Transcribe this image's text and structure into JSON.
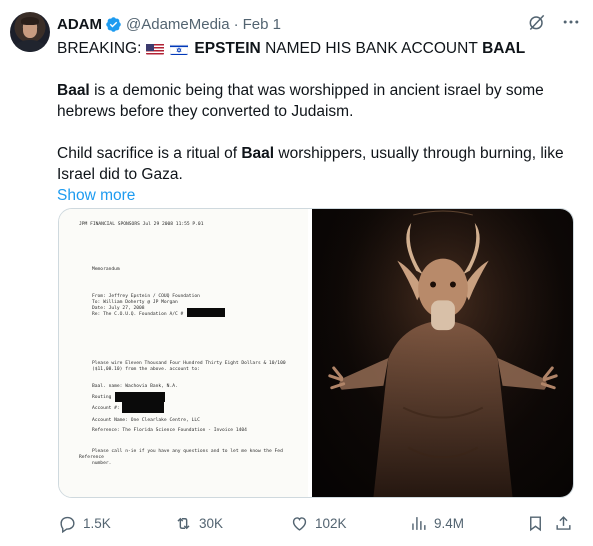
{
  "author": {
    "name": "ADAM",
    "handle": "@AdameMedia",
    "separator": "·",
    "date": "Feb 1",
    "verified": true
  },
  "tweet": {
    "line1_prefix": "BREAKING:",
    "line1_bold": "EPSTEIN",
    "line1_mid": "NAMED HIS BANK ACCOUNT",
    "line1_bold2": "BAAL",
    "p2_bold": "Baal",
    "p2_rest": "is a demonic being that was worshipped in ancient israel by some hebrews before they converted to Judaism.",
    "p3_start": "Child sacrifice is a ritual of",
    "p3_bold": "Baal",
    "p3_rest": "worshippers, usually through burning, like Israel did to Gaza.",
    "show_more": "Show more"
  },
  "flags": [
    "us-flag-icon",
    "israel-flag-icon"
  ],
  "document_image": {
    "header": "JPM FINANCIAL SPONSORS   Jul 29 2008 11:55 P.01",
    "memo": "Memorandum",
    "from": "From: Jeffrey Epstein / COUQ Foundation",
    "to": "To: William Doherty @ JP Morgan",
    "date": "Date: July 27, 2008",
    "re": "Re: The C.O.U.Q. Foundation A/C #",
    "wire1": "Please wire Eleven Thousand Four Hundred Thirty Eight Dollars & 10/100",
    "wire2": "($11,08.10) from the above. account to:",
    "bank": "Baal. name: Wachovia Bank, N.A.",
    "routing": "Routing",
    "account": "Account #:",
    "account_name": "Account Name: One Clearlake Centre, LLC",
    "reference": "Reference: The Florida Science Foundation - Invoice 1404",
    "please1": "Please call n-ie if you have any questions and to let me know the Fed",
    "please2": "Reference",
    "please3": "number."
  },
  "actions": {
    "replies": "1.5K",
    "reposts": "30K",
    "likes": "102K",
    "views": "9.4M"
  },
  "colors": {
    "text": "#0f1419",
    "muted": "#536471",
    "link": "#1d9bf0",
    "verified": "#1d9bf0",
    "border": "#cfd9de"
  }
}
